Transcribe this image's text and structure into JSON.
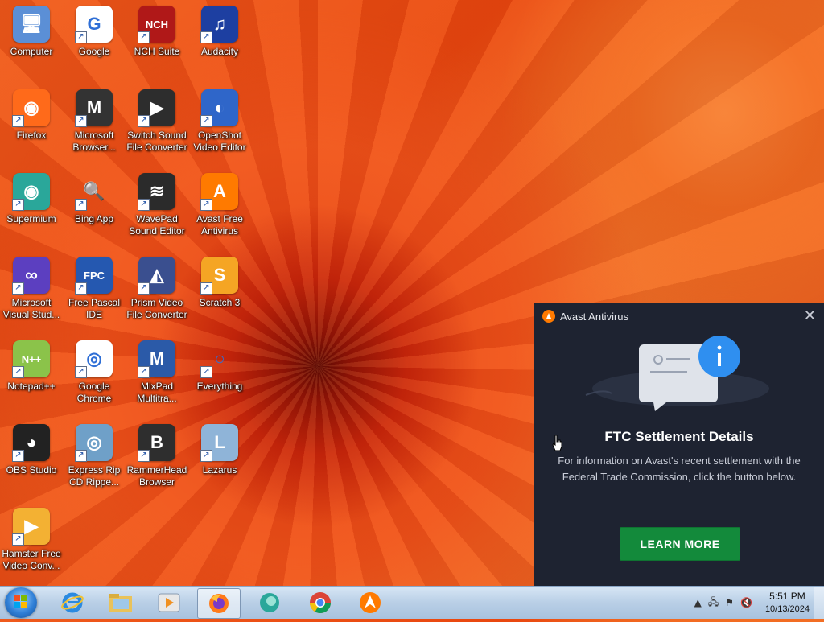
{
  "desktop": {
    "icons": [
      {
        "name": "Computer",
        "icon": "computer-icon",
        "color": "#5b8fd6",
        "glyph": "🖥",
        "shortcut": false
      },
      {
        "name": "Google",
        "icon": "google-icon",
        "color": "#ffffff",
        "glyph": "G",
        "shortcut": true
      },
      {
        "name": "NCH Suite",
        "icon": "nch-suite-icon",
        "color": "#b01818",
        "glyph": "NCH",
        "shortcut": true
      },
      {
        "name": "Audacity",
        "icon": "audacity-icon",
        "color": "#1d3fa1",
        "glyph": "♫",
        "shortcut": true
      },
      {
        "name": "Firefox",
        "icon": "firefox-icon",
        "color": "#ff6a1a",
        "glyph": "◉",
        "shortcut": true
      },
      {
        "name": "Microsoft Browser...",
        "icon": "microsoft-browser-icon",
        "color": "#333333",
        "glyph": "M",
        "shortcut": true
      },
      {
        "name": "Switch Sound File Converter",
        "icon": "switch-sound-icon",
        "color": "#2d2d2d",
        "glyph": "▶",
        "shortcut": true
      },
      {
        "name": "OpenShot Video Editor",
        "icon": "openshot-icon",
        "color": "#2f66c9",
        "glyph": "◐",
        "shortcut": true
      },
      {
        "name": "Supermium",
        "icon": "supermium-icon",
        "color": "#2aa79a",
        "glyph": "◉",
        "shortcut": true
      },
      {
        "name": "Bing App",
        "icon": "bing-icon",
        "color": "transparent",
        "glyph": "🔍",
        "shortcut": true
      },
      {
        "name": "WavePad Sound Editor",
        "icon": "wavepad-icon",
        "color": "#2b2b2b",
        "glyph": "≋",
        "shortcut": true
      },
      {
        "name": "Avast Free Antivirus",
        "icon": "avast-icon",
        "color": "#ff7a00",
        "glyph": "A",
        "shortcut": true
      },
      {
        "name": "Microsoft Visual Stud...",
        "icon": "visual-studio-icon",
        "color": "#5c3fc0",
        "glyph": "∞",
        "shortcut": true
      },
      {
        "name": "Free Pascal IDE",
        "icon": "free-pascal-icon",
        "color": "#2558b0",
        "glyph": "FPC",
        "shortcut": true
      },
      {
        "name": "Prism Video File Converter",
        "icon": "prism-icon",
        "color": "#3a4f8f",
        "glyph": "◭",
        "shortcut": true
      },
      {
        "name": "Scratch 3",
        "icon": "scratch-icon",
        "color": "#f5a524",
        "glyph": "S",
        "shortcut": true
      },
      {
        "name": "Notepad++",
        "icon": "notepad-plus-plus-icon",
        "color": "#8bc34a",
        "glyph": "N++",
        "shortcut": true
      },
      {
        "name": "Google Chrome",
        "icon": "chrome-icon",
        "color": "#ffffff",
        "glyph": "◎",
        "shortcut": true
      },
      {
        "name": "MixPad Multitra...",
        "icon": "mixpad-icon",
        "color": "#2b5aa8",
        "glyph": "M",
        "shortcut": true
      },
      {
        "name": "Everything",
        "icon": "everything-icon",
        "color": "transparent",
        "glyph": "○",
        "shortcut": true
      },
      {
        "name": "OBS Studio",
        "icon": "obs-icon",
        "color": "#222222",
        "glyph": "◕",
        "shortcut": true
      },
      {
        "name": "Express Rip CD Rippe...",
        "icon": "express-rip-icon",
        "color": "#6fa0c8",
        "glyph": "◎",
        "shortcut": true
      },
      {
        "name": "RammerHead Browser",
        "icon": "rammerhead-icon",
        "color": "#2e2e2e",
        "glyph": "B",
        "shortcut": true
      },
      {
        "name": "Lazarus",
        "icon": "lazarus-icon",
        "color": "#8fb4d8",
        "glyph": "L",
        "shortcut": true
      },
      {
        "name": "Hamster Free Video Conv...",
        "icon": "hamster-icon",
        "color": "#f3b133",
        "glyph": "▶",
        "shortcut": true
      }
    ]
  },
  "avast_popup": {
    "app_name": "Avast Antivirus",
    "heading": "FTC Settlement Details",
    "description": "For information on Avast's recent settlement with the Federal Trade Commission, click the button below.",
    "button_label": "LEARN MORE",
    "accent": "#ff7a00",
    "button_color": "#138a3b"
  },
  "taskbar": {
    "pinned": [
      "internet-explorer-icon",
      "file-explorer-icon",
      "media-player-icon",
      "firefox-icon",
      "supermium-icon",
      "chrome-icon",
      "avast-icon"
    ],
    "clock_time": "5:51 PM",
    "clock_date": "10/13/2024"
  }
}
